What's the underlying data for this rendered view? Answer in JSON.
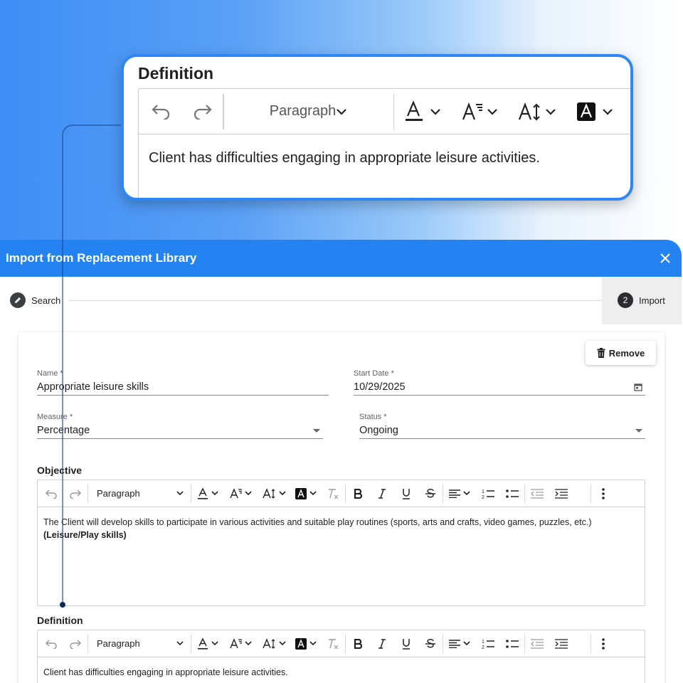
{
  "callout": {
    "title": "Definition",
    "paragraph_label": "Paragraph",
    "text": "Client has difficulties engaging in appropriate leisure activities."
  },
  "modal": {
    "title": "Import from Replacement Library",
    "close_icon": "close-icon"
  },
  "stepper": {
    "step1_label": "Search",
    "step2_number": "2",
    "step2_label": "Import"
  },
  "form": {
    "remove_label": "Remove",
    "name": {
      "label": "Name *",
      "value": "Appropriate leisure skills"
    },
    "start_date": {
      "label": "Start Date *",
      "value": "10/29/2025"
    },
    "measure": {
      "label": "Measure *",
      "value": "Percentage"
    },
    "status": {
      "label": "Status *",
      "value": "Ongoing"
    }
  },
  "objective": {
    "title": "Objective",
    "paragraph_label": "Paragraph",
    "text": "The Client will develop skills to participate in various activities and suitable play routines (sports, arts and crafts, video games, puzzles, etc.)",
    "bold_text": "(Leisure/Play skills)"
  },
  "definition": {
    "title": "Definition",
    "paragraph_label": "Paragraph",
    "text": "Client has difficulties engaging in appropriate leisure activities."
  },
  "colors": {
    "accent": "#2482f1",
    "callout_border": "#2f86f6"
  }
}
